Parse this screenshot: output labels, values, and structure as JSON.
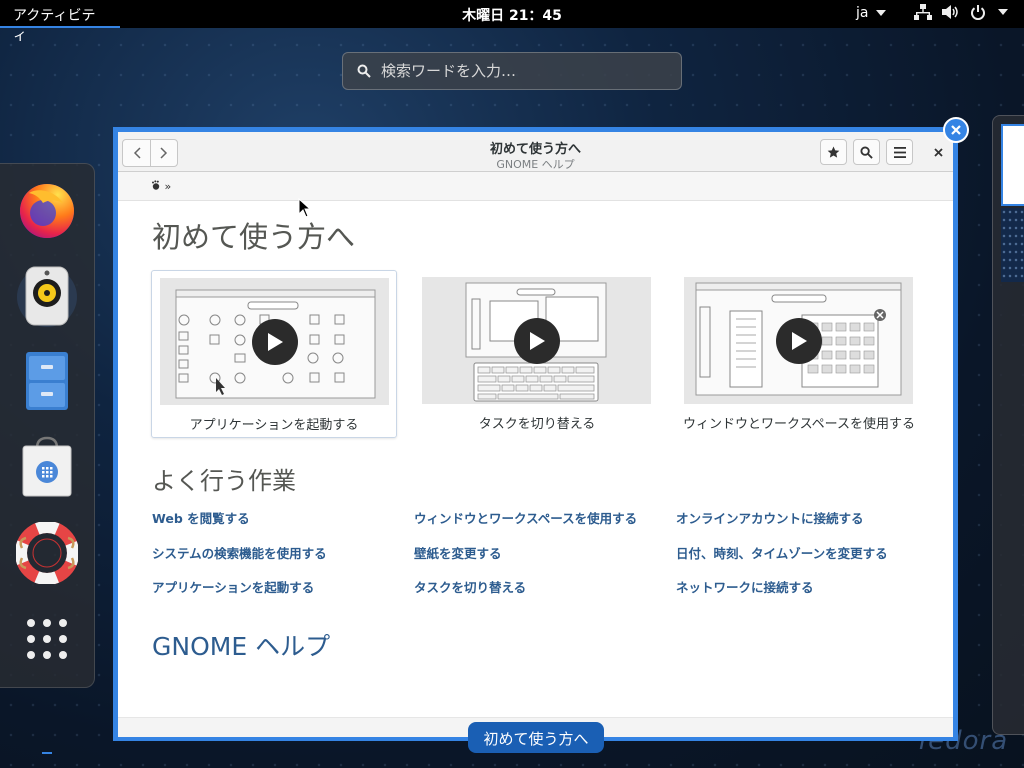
{
  "topbar": {
    "activities": "アクティビティ",
    "clock": "木曜日 21：45",
    "lang": "ja"
  },
  "search": {
    "placeholder": "検索ワードを入力…"
  },
  "dash": {
    "items": [
      {
        "name": "firefox",
        "icon": "firefox-icon"
      },
      {
        "name": "rhythmbox",
        "icon": "speaker-icon"
      },
      {
        "name": "files",
        "icon": "file-cabinet-icon"
      },
      {
        "name": "software",
        "icon": "shopping-bag-icon"
      },
      {
        "name": "help",
        "icon": "lifebuoy-icon"
      },
      {
        "name": "show-apps",
        "icon": "app-grid-icon"
      }
    ]
  },
  "window": {
    "title": "初めて使う方へ",
    "subtitle": "GNOME ヘルプ",
    "heading": "初めて使う方へ",
    "videos": [
      {
        "caption": "アプリケーションを起動する"
      },
      {
        "caption": "タスクを切り替える"
      },
      {
        "caption": "ウィンドウとワークスペースを使用する"
      }
    ],
    "tasks_heading": "よく行う作業",
    "tasks": [
      [
        "Web を閲覧する",
        "システムの検索機能を使用する",
        "アプリケーションを起動する"
      ],
      [
        "ウィンドウとワークスペースを使用する",
        "壁紙を変更する",
        "タスクを切り替える"
      ],
      [
        "オンラインアカウントに接続する",
        "日付、時刻、タイムゾーンを変更する",
        "ネットワークに接続する"
      ]
    ],
    "help_link": "GNOME ヘルプ",
    "footer_fragment": "て"
  },
  "window_label": "初めて使う方へ",
  "watermark": "fedora",
  "colors": {
    "accent": "#3584e4",
    "link": "#2d5c8f",
    "heading": "#555753"
  }
}
